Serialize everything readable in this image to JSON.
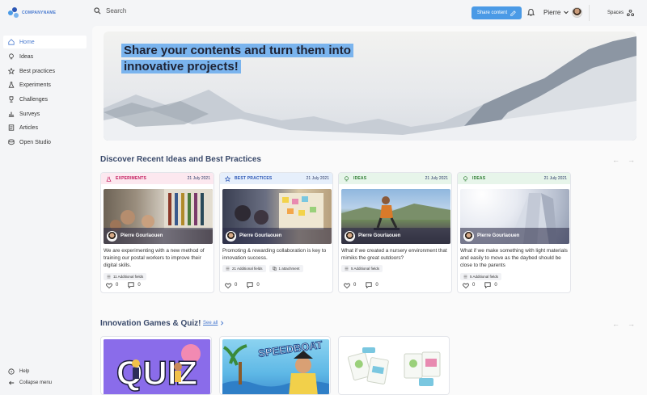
{
  "brand": {
    "logo_text": "COMPANYNAME"
  },
  "search": {
    "placeholder": "Search"
  },
  "header": {
    "share_label": "Share content",
    "user_name": "Pierre",
    "spaces_label": "Spaces"
  },
  "sidebar": {
    "items": [
      {
        "label": "Home",
        "icon": "home-icon"
      },
      {
        "label": "Ideas",
        "icon": "lightbulb-icon"
      },
      {
        "label": "Best practices",
        "icon": "star-icon"
      },
      {
        "label": "Experiments",
        "icon": "flask-icon"
      },
      {
        "label": "Challenges",
        "icon": "trophy-icon"
      },
      {
        "label": "Surveys",
        "icon": "chart-icon"
      },
      {
        "label": "Articles",
        "icon": "article-icon"
      },
      {
        "label": "Open Studio",
        "icon": "studio-icon"
      }
    ],
    "help_label": "Help",
    "collapse_label": "Collapse menu"
  },
  "hero": {
    "line1": "Share your contents and turn them into",
    "line2": "innovative projects!"
  },
  "recent": {
    "title": "Discover Recent Ideas and Best Practices",
    "cards": [
      {
        "type": "EXPERIMENTS",
        "date": "21 July 2021",
        "author": "Pierre Gourlaouen",
        "text": "We are experimenting with a new method of training our postal workers to improve their digital skills.",
        "tag1": "11 Additional fields",
        "tag2": "",
        "likes": "0",
        "comments": "0",
        "color": "#c2185b",
        "bg": "#fce8ef"
      },
      {
        "type": "BEST PRACTICES",
        "date": "21 July 2021",
        "author": "Pierre Gourlaouen",
        "text": "Promoting & rewarding collaboration is key to innovation success.",
        "tag1": "21 Additional fields",
        "tag2": "1 attachment",
        "likes": "0",
        "comments": "0",
        "color": "#2b56b5",
        "bg": "#e6effb"
      },
      {
        "type": "IDEAS",
        "date": "21 July 2021",
        "author": "Pierre Gourlaouen",
        "text": "What if we created a nursery environment that mimiks the great outdoors?",
        "tag1": "5 Additional fields",
        "tag2": "",
        "likes": "0",
        "comments": "0",
        "color": "#2e7d32",
        "bg": "#e7f5ea"
      },
      {
        "type": "IDEAS",
        "date": "21 July 2021",
        "author": "Pierre Gourlaouen",
        "text": "What if we make something with light materials and easily to move as the daybed should be close to the parents",
        "tag1": "5 Additional fields",
        "tag2": "",
        "likes": "0",
        "comments": "0",
        "color": "#2e7d32",
        "bg": "#e7f5ea"
      }
    ]
  },
  "games": {
    "title": "Innovation Games & Quiz!",
    "see_all": "See all",
    "quiz_word": "QUIZ",
    "speedboat_word": "SPEEDBOAT"
  },
  "colors": {
    "accent": "#4a9ae6",
    "hero_highlight": "#7ab4ee",
    "heading": "#3a4a6b"
  }
}
